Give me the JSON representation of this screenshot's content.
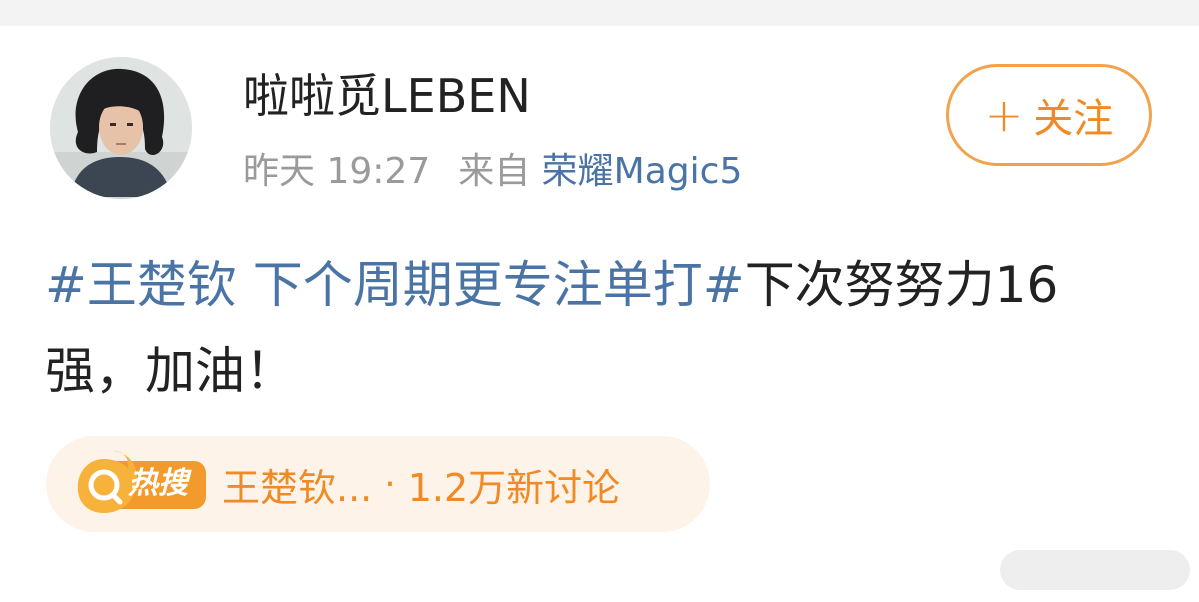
{
  "post": {
    "username": "啦啦觅LEBEN",
    "time": "昨天 19:27",
    "from_label": "来自",
    "device": "荣耀Magic5",
    "follow_label": "关注",
    "follow_plus": "+",
    "content": {
      "hashtag": "#王楚钦 下个周期更专注单打#",
      "text": "下次努努力16强，加油！"
    },
    "hot_search": {
      "badge": "热搜",
      "title": "王楚钦...",
      "separator": "·",
      "count": "1.2万新讨论"
    }
  },
  "colors": {
    "link_blue": "#4a74a6",
    "accent_orange": "#f08a24",
    "hot_bg": "#fdf3e8",
    "meta_gray": "#9a9a9a"
  },
  "icons": {
    "avatar": "user-avatar-photo",
    "hot_search": "search-flame-icon",
    "share": "share-pill"
  }
}
